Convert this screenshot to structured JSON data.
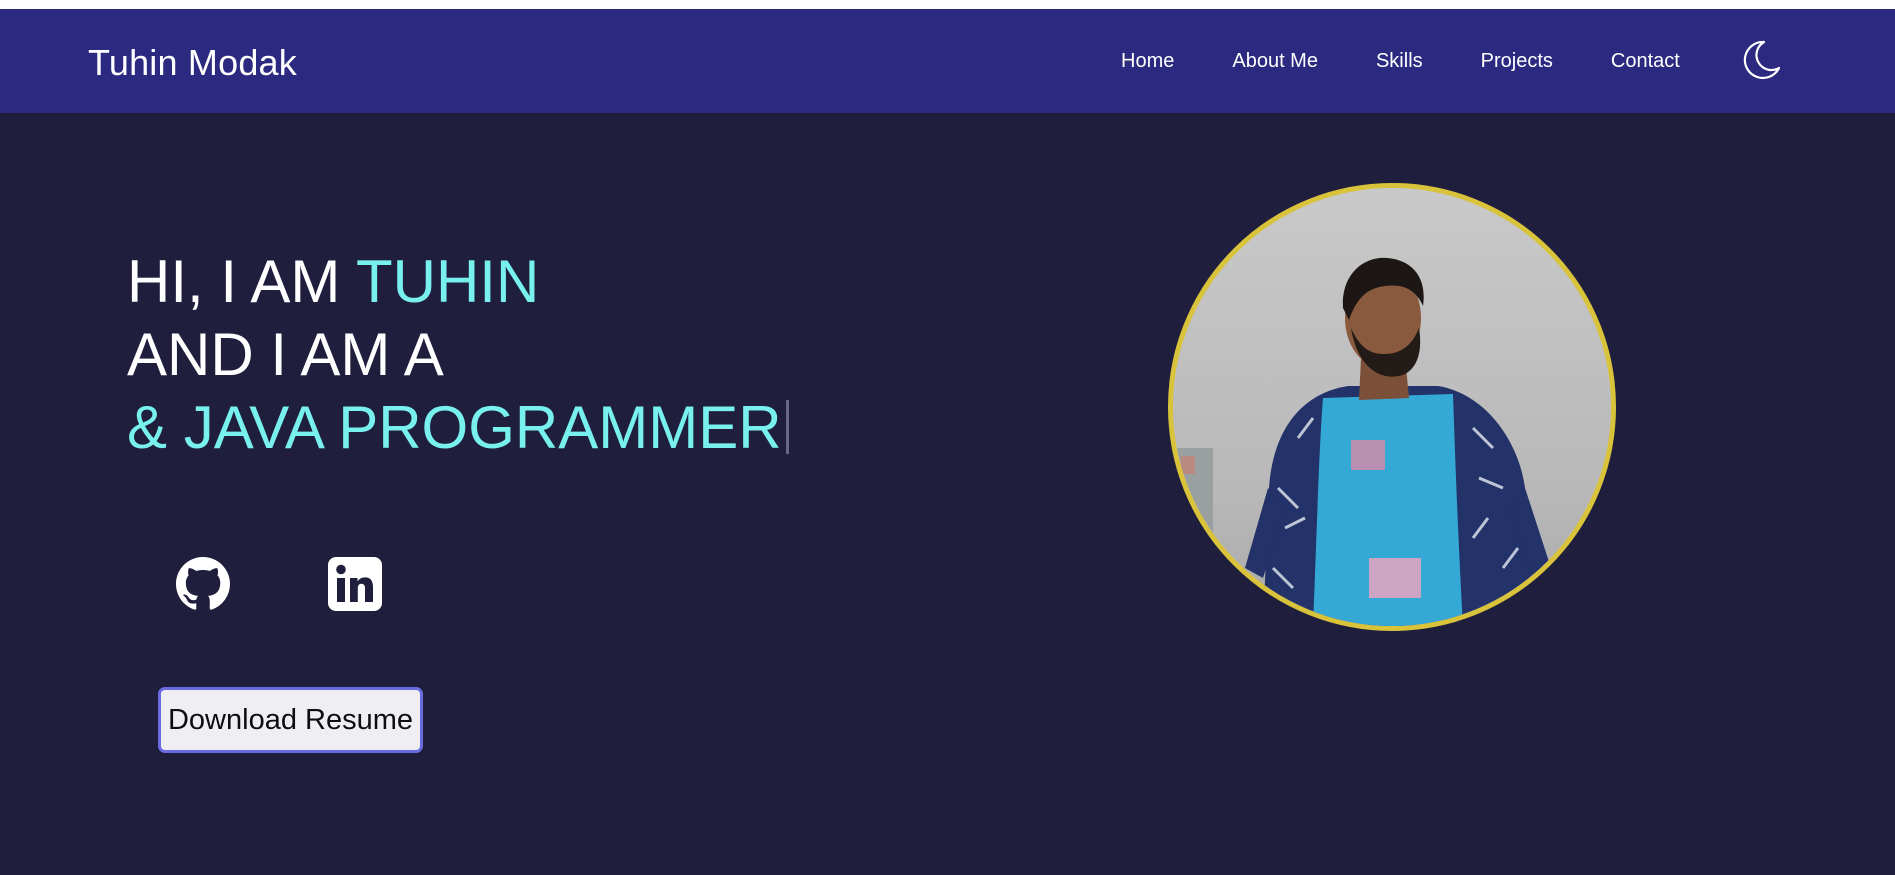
{
  "header": {
    "brand": "Tuhin Modak",
    "nav": [
      "Home",
      "About Me",
      "Skills",
      "Projects",
      "Contact"
    ],
    "theme_toggle_icon": "moon-icon"
  },
  "hero": {
    "line1_prefix": "HI, I AM ",
    "line1_name": "TUHIN",
    "line2": "AND I AM A",
    "line3_typed": "& JAVA PROGRAMMER"
  },
  "socials": {
    "github_icon": "github-icon",
    "linkedin_icon": "linkedin-icon"
  },
  "actions": {
    "resume_label": "Download Resume"
  },
  "profile": {
    "ring_color": "#d9c33b"
  },
  "colors": {
    "background": "#201e3d",
    "navbar": "#2b2a80",
    "accent": "#77f0ee",
    "button_border": "#6b6be0"
  }
}
